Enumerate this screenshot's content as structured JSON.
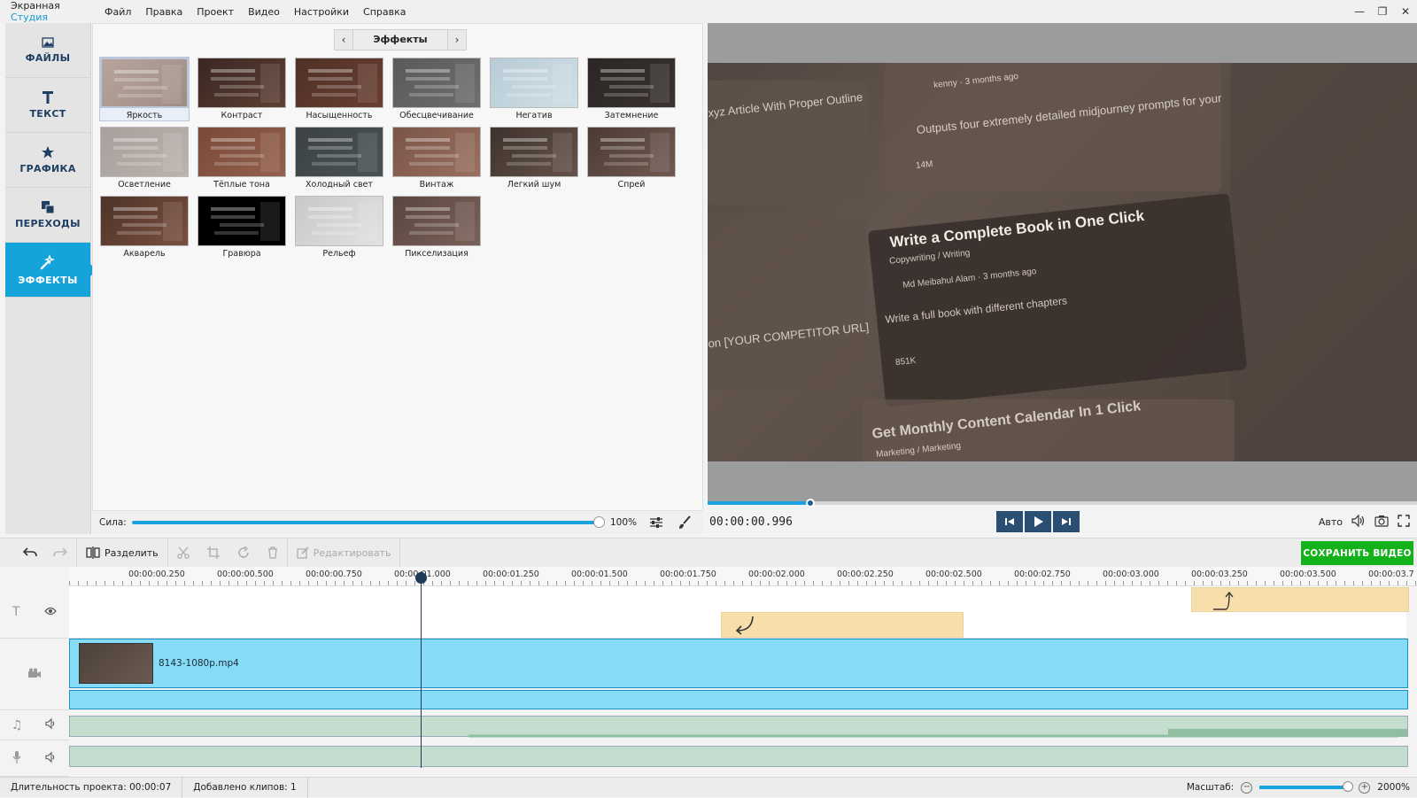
{
  "app": {
    "name_part1": "Экранная ",
    "name_part2": "Студия"
  },
  "menu": [
    "Файл",
    "Правка",
    "Проект",
    "Видео",
    "Настройки",
    "Справка"
  ],
  "window_controls": [
    "minimize-icon",
    "restore-icon",
    "close-icon"
  ],
  "sidebar": {
    "items": [
      {
        "label": "ФАЙЛЫ",
        "icon": "image-icon"
      },
      {
        "label": "ТЕКСТ",
        "icon": "text-icon"
      },
      {
        "label": "ГРАФИКА",
        "icon": "star-icon"
      },
      {
        "label": "ПЕРЕХОДЫ",
        "icon": "transitions-icon"
      },
      {
        "label": "ЭФФЕКТЫ",
        "icon": "magic-wand-icon",
        "active": true
      }
    ]
  },
  "effects": {
    "title": "Эффекты",
    "items": [
      {
        "name": "Яркость",
        "selected": true,
        "bg": "linear-gradient(135deg,#b7a49b,#9f8d85)"
      },
      {
        "name": "Контраст",
        "bg": "linear-gradient(135deg,#3a2722,#5e4034)"
      },
      {
        "name": "Насыщенность",
        "bg": "linear-gradient(135deg,#4f3027,#6a3f32)"
      },
      {
        "name": "Обесцвечивание",
        "bg": "linear-gradient(135deg,#5a5a5a,#6e6e6e)"
      },
      {
        "name": "Негатив",
        "bg": "linear-gradient(135deg,#b8cbd6,#cfdfe6)"
      },
      {
        "name": "Затемнение",
        "bg": "linear-gradient(135deg,#2b2624,#3a3330)"
      },
      {
        "name": "Осветление",
        "bg": "linear-gradient(135deg,#a8a09c,#bab2ad)"
      },
      {
        "name": "Тёплые тона",
        "bg": "linear-gradient(135deg,#7a4a3a,#93604c)"
      },
      {
        "name": "Холодный свет",
        "bg": "linear-gradient(135deg,#3c4244,#4b5254)"
      },
      {
        "name": "Винтаж",
        "bg": "linear-gradient(135deg,#7a5548,#9a7060)"
      },
      {
        "name": "Легкий шум",
        "bg": "linear-gradient(135deg,#3f322c,#64534a)"
      },
      {
        "name": "Спрей",
        "bg": "linear-gradient(135deg,#4c3b34,#705a50)"
      },
      {
        "name": "Акварель",
        "bg": "linear-gradient(135deg,#4e3328,#7a5040)"
      },
      {
        "name": "Гравюра",
        "bg": "#000000"
      },
      {
        "name": "Рельеф",
        "bg": "linear-gradient(135deg,#c8c8c8,#e2e2e2)"
      },
      {
        "name": "Пикселизация",
        "bg": "linear-gradient(135deg,#5a4640,#7a6158)"
      }
    ]
  },
  "strength": {
    "label": "Сила:",
    "value_text": "100%",
    "value": 1.0
  },
  "player": {
    "time": "00:00:00.996",
    "progress": 0.145,
    "auto_label": "Авто",
    "video_texts": {
      "card_title": "Write a Complete Book in One Click",
      "card_cat": "Copywriting / Writing",
      "card_author": "Md Meibahul Alam · 3 months ago",
      "card_desc": "Write a full book with different chapters",
      "card_views": "851K",
      "top_text": "Outputs four extremely detailed midjourney prompts for your",
      "top_author": "kenny · 3 months ago",
      "top_views": "14M",
      "left_text": "xyz Article With Proper Outline",
      "left_text2": "on [YOUR COMPETITOR URL]",
      "bottom_text": "Get Monthly Content Calendar In 1 Click",
      "bottom_cat": "Marketing / Marketing"
    }
  },
  "toolbar": {
    "split": "Разделить",
    "edit": "Редактировать",
    "save": "СОХРАНИТЬ ВИДЕО"
  },
  "timeline": {
    "ticks": [
      "00:00:00.250",
      "00:00:00.500",
      "00:00:00.750",
      "00:00:01.000",
      "00:00:01.250",
      "00:00:01.500",
      "00:00:01.750",
      "00:00:02.000",
      "00:00:02.250",
      "00:00:02.500",
      "00:00:02.750",
      "00:00:03.000",
      "00:00:03.250",
      "00:00:03.500",
      "00:00:03.7"
    ],
    "video_clip": "8143-1080p.mp4"
  },
  "status": {
    "duration": "Длительность проекта:  00:00:07",
    "clips": "Добавлено клипов: 1",
    "zoom_label": "Масштаб:",
    "zoom_value": "2000%"
  }
}
